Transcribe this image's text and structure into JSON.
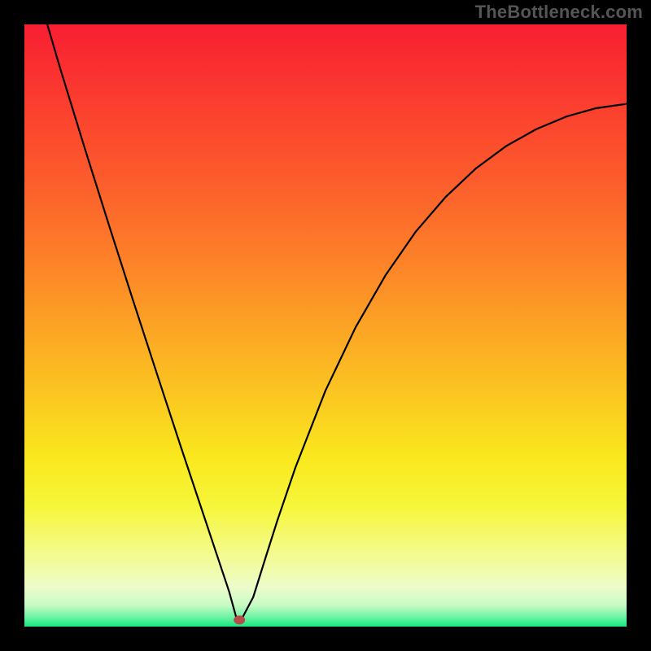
{
  "watermark": "TheBottleneck.com",
  "colors": {
    "frame": "#000000",
    "gradient_stops": [
      {
        "offset": 0.0,
        "color": "#f81e32"
      },
      {
        "offset": 0.12,
        "color": "#fb3b2f"
      },
      {
        "offset": 0.25,
        "color": "#fc5a2c"
      },
      {
        "offset": 0.38,
        "color": "#fd7e29"
      },
      {
        "offset": 0.5,
        "color": "#fca325"
      },
      {
        "offset": 0.62,
        "color": "#fbc821"
      },
      {
        "offset": 0.72,
        "color": "#fae81e"
      },
      {
        "offset": 0.8,
        "color": "#f6f63a"
      },
      {
        "offset": 0.88,
        "color": "#f4fb8e"
      },
      {
        "offset": 0.935,
        "color": "#ecfccb"
      },
      {
        "offset": 0.965,
        "color": "#c7fbc3"
      },
      {
        "offset": 0.985,
        "color": "#68f3a0"
      },
      {
        "offset": 1.0,
        "color": "#17e880"
      }
    ],
    "curve": "#000000",
    "marker": "#b84b4b"
  },
  "chart_data": {
    "type": "line",
    "title": "",
    "xlabel": "",
    "ylabel": "",
    "xlim": [
      0,
      100
    ],
    "ylim": [
      0,
      100
    ],
    "grid": false,
    "series": [
      {
        "name": "bottleneck_curve",
        "x": [
          3.8,
          6,
          10,
          14,
          18,
          22,
          26,
          28,
          30,
          31,
          32,
          33,
          34,
          34.8,
          35.3,
          36,
          38,
          40,
          42,
          45,
          50,
          55,
          60,
          65,
          70,
          75,
          80,
          85,
          90,
          95,
          100
        ],
        "y": [
          100,
          92.5,
          79.5,
          66.8,
          54.3,
          42.0,
          29.8,
          23.8,
          17.8,
          14.8,
          11.8,
          8.8,
          5.8,
          2.9,
          1.1,
          1.1,
          4.9,
          11.3,
          17.6,
          26.4,
          39.2,
          49.7,
          58.4,
          65.6,
          71.4,
          76.1,
          79.8,
          82.6,
          84.7,
          86.1,
          86.8
        ]
      }
    ],
    "marker": {
      "x": 35.7,
      "y": 1.1
    },
    "annotations": []
  }
}
